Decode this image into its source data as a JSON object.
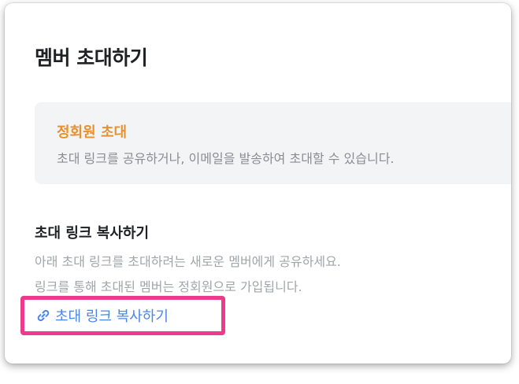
{
  "dialog": {
    "title": "멤버 초대하기"
  },
  "info": {
    "title": "정회원 초대",
    "description": "초대 링크를 공유하거나, 이메일을 발송하여 초대할 수 있습니다."
  },
  "link_section": {
    "title": "초대 링크 복사하기",
    "description_line1": "아래 초대 링크를 초대하려는 새로운 멤버에게 공유하세요.",
    "description_line2": "링크를 통해 초대된 멤버는 정회원으로 가입됩니다.",
    "copy_label": "초대 링크 복사하기",
    "copy_icon": "link-icon"
  },
  "colors": {
    "accent_orange": "#e8912f",
    "link_blue": "#4a86e8",
    "highlight_pink": "#ec3a8c"
  }
}
